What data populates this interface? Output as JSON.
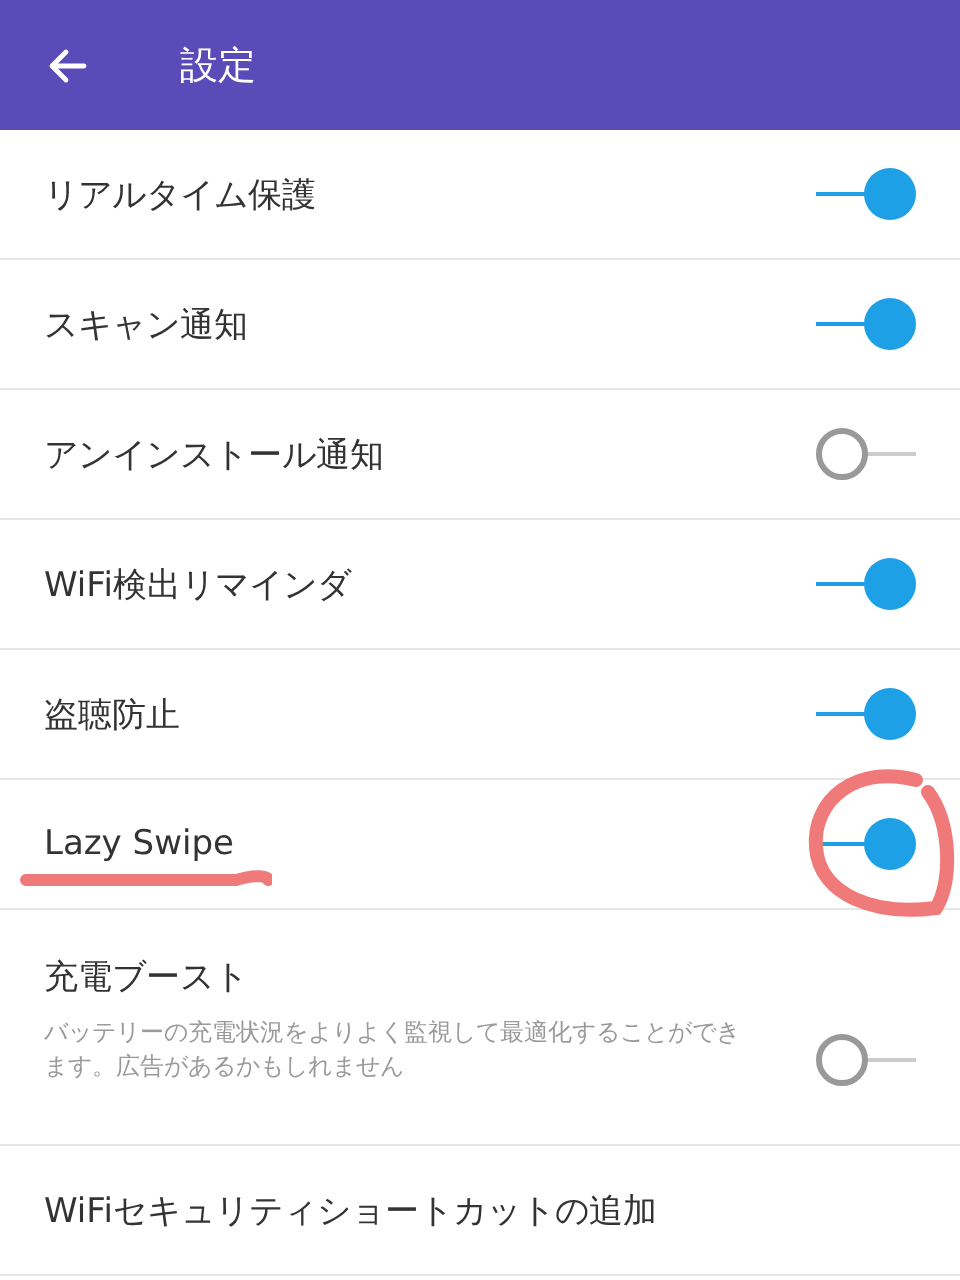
{
  "app_bar": {
    "title": "設定"
  },
  "settings": [
    {
      "kind": "toggle",
      "label": "リアルタイム保護",
      "on": true,
      "annotated": false
    },
    {
      "kind": "toggle",
      "label": "スキャン通知",
      "on": true,
      "annotated": false
    },
    {
      "kind": "toggle",
      "label": "アンインストール通知",
      "on": false,
      "annotated": false
    },
    {
      "kind": "toggle",
      "label": "WiFi検出リマインダ",
      "on": true,
      "annotated": false
    },
    {
      "kind": "toggle",
      "label": "盗聴防止",
      "on": true,
      "annotated": false
    },
    {
      "kind": "toggle",
      "label": "Lazy Swipe",
      "on": true,
      "annotated": true
    },
    {
      "kind": "toggle",
      "label": "充電ブースト",
      "description": "バッテリーの充電状況をよりよく監視して最適化することができます。広告があるかもしれません",
      "on": false,
      "annotated": false
    },
    {
      "kind": "link",
      "label": "WiFiセキュリティショートカットの追加"
    }
  ]
}
